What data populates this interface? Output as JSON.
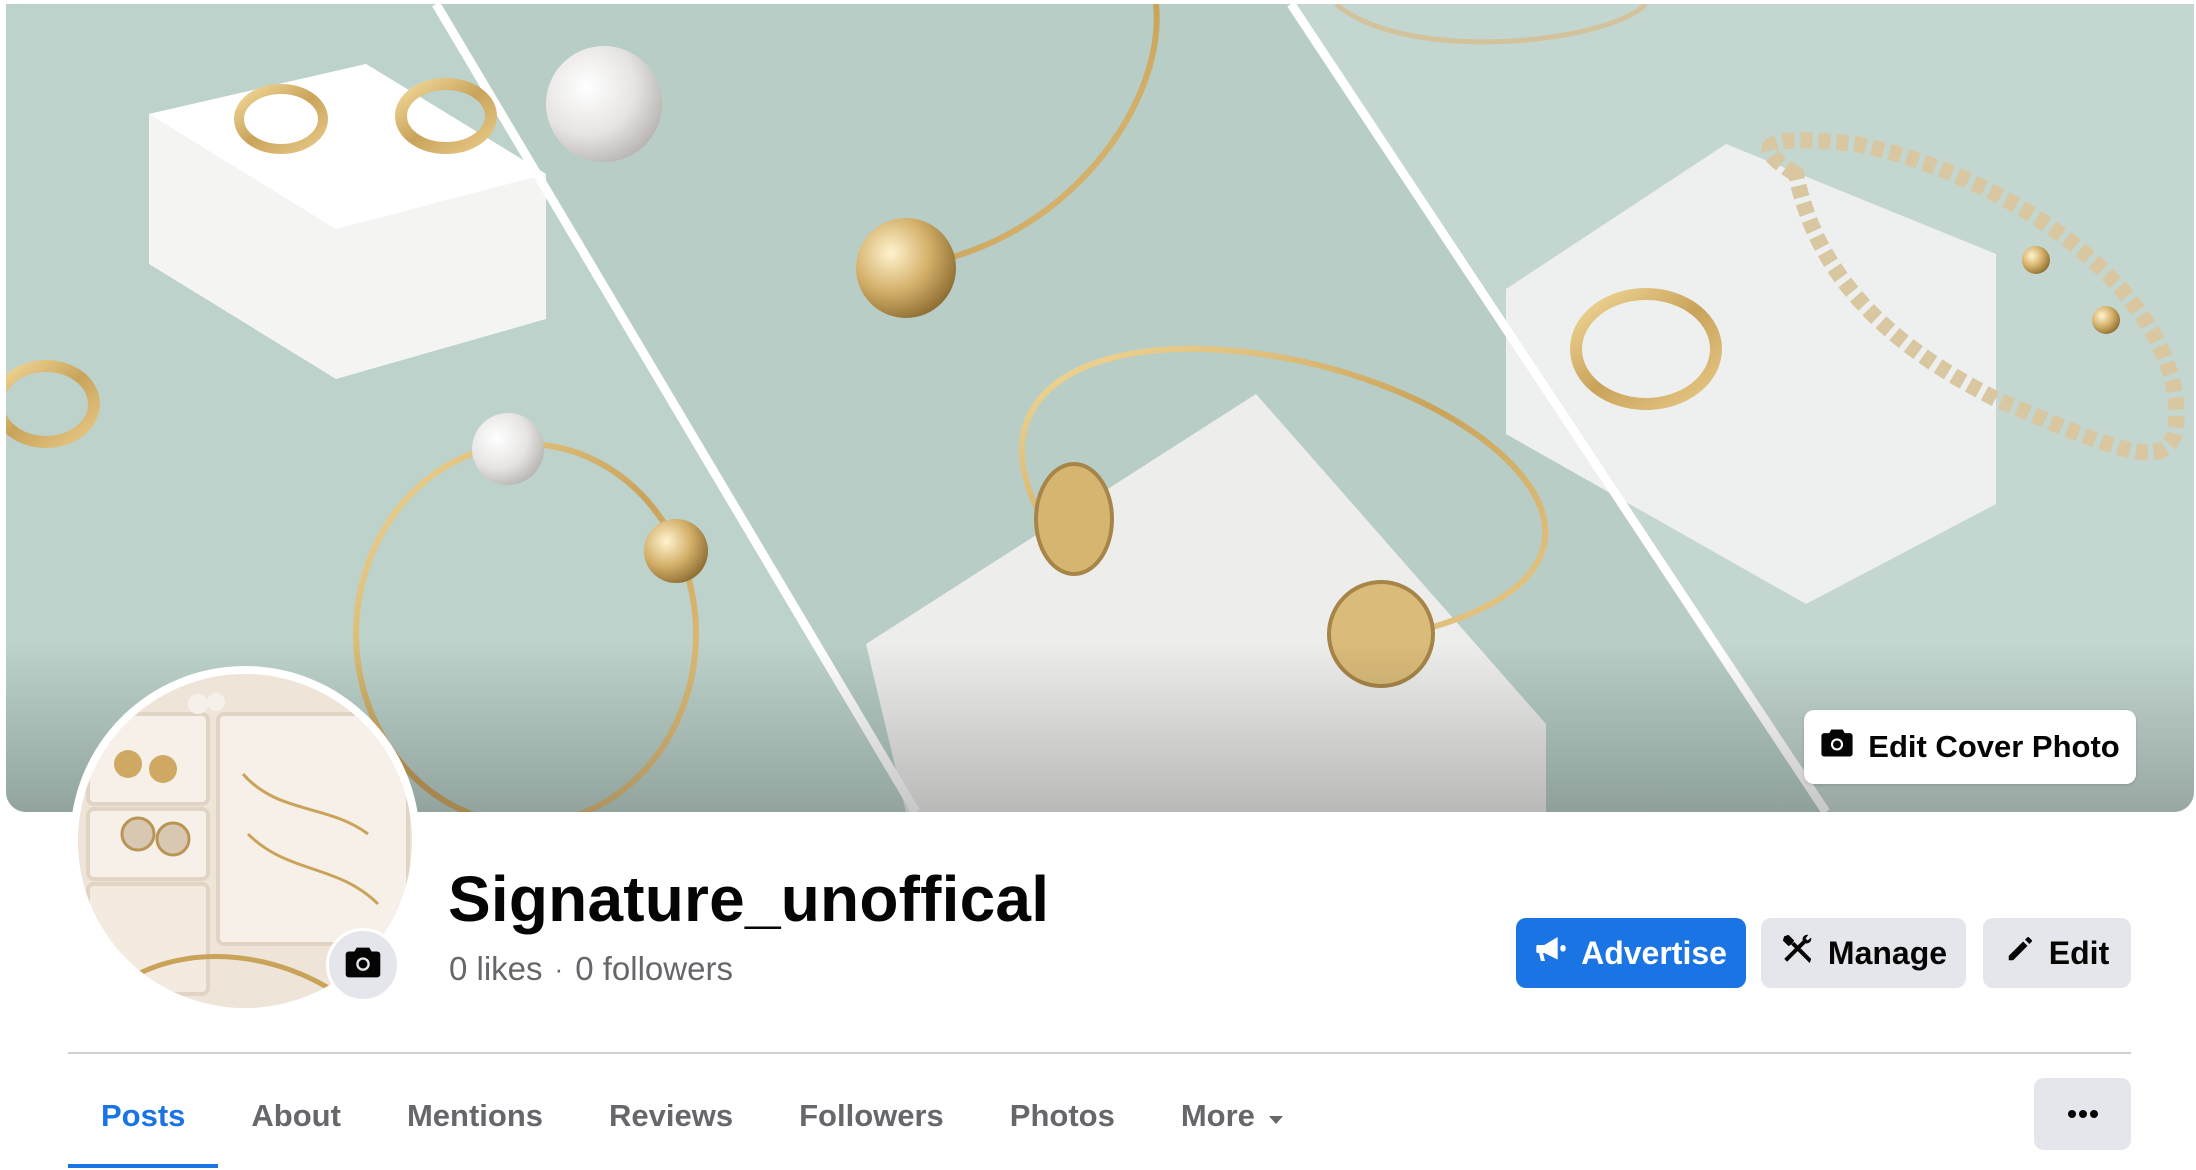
{
  "cover": {
    "edit_label": "Edit Cover Photo",
    "icon": "camera-icon"
  },
  "profile": {
    "name": "Signature_unoffical",
    "likes": "0 likes",
    "separator": "·",
    "followers": "0 followers",
    "avatar_icon": "camera-icon"
  },
  "actions": {
    "advertise": "Advertise",
    "manage": "Manage",
    "edit": "Edit",
    "advertise_icon": "megaphone-icon",
    "manage_icon": "tools-icon",
    "edit_icon": "pencil-icon"
  },
  "tabs": [
    {
      "label": "Posts",
      "active": true
    },
    {
      "label": "About",
      "active": false
    },
    {
      "label": "Mentions",
      "active": false
    },
    {
      "label": "Reviews",
      "active": false
    },
    {
      "label": "Followers",
      "active": false
    },
    {
      "label": "Photos",
      "active": false
    },
    {
      "label": "More",
      "active": false
    }
  ],
  "overflow_menu_icon": "more-dots-icon",
  "colors": {
    "accent": "#1b74e4",
    "button_gray": "#e4e6eb",
    "secondary_text": "#65676b",
    "cover_bg": "#b9cfc8"
  }
}
